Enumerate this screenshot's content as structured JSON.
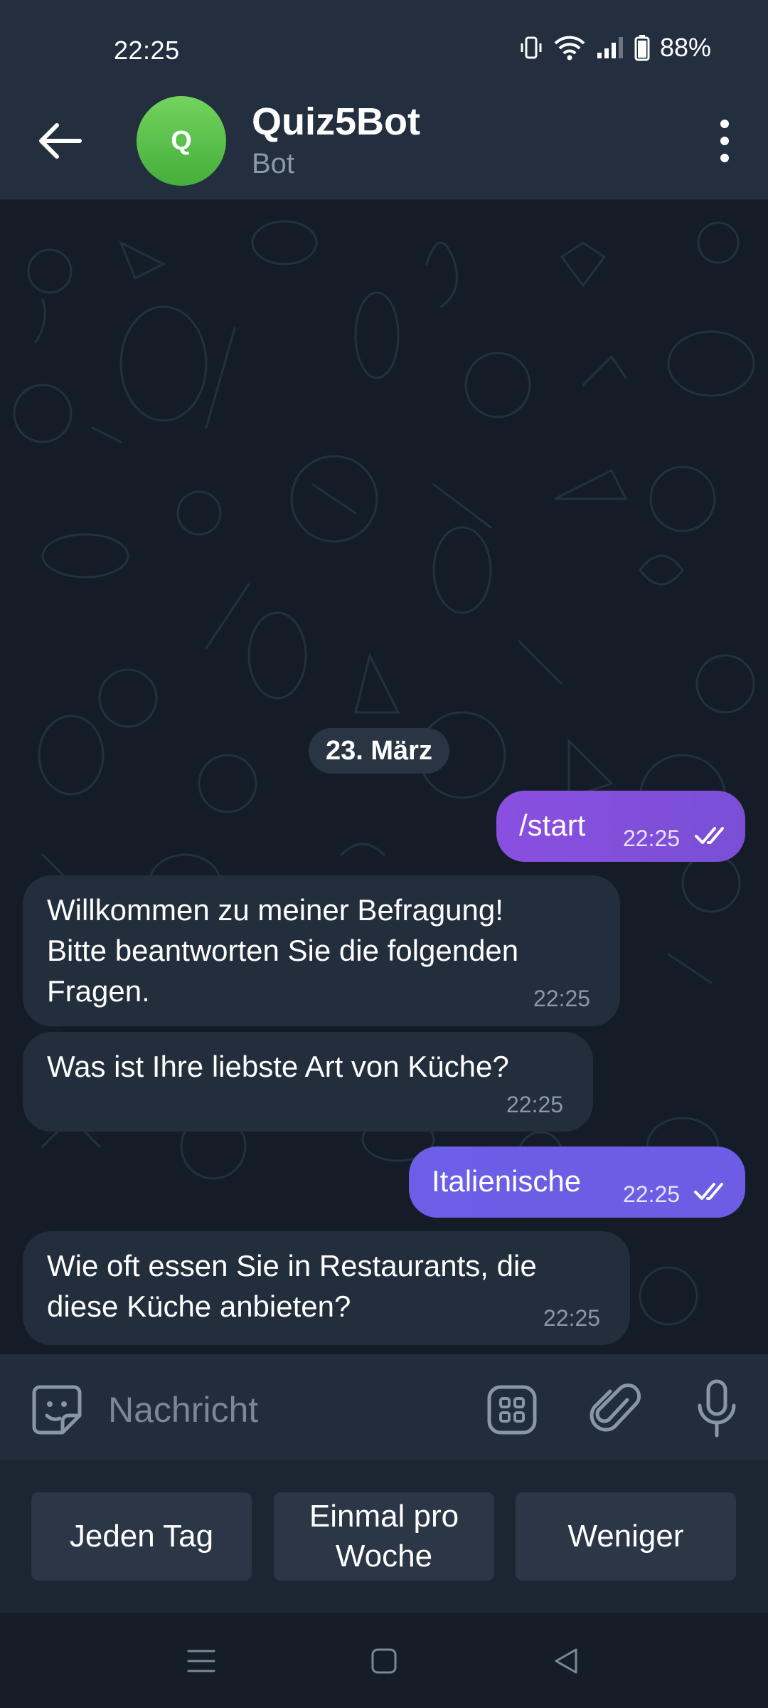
{
  "status_bar": {
    "time": "22:25",
    "battery": "88%"
  },
  "header": {
    "avatar_letter": "Q",
    "title": "Quiz5Bot",
    "subtitle": "Bot"
  },
  "chat": {
    "date_separator": "23. März",
    "messages": [
      {
        "direction": "out",
        "text": "/start",
        "time": "22:25",
        "status": "read"
      },
      {
        "direction": "in",
        "lines": [
          "Willkommen zu meiner Befragung!",
          "Bitte beantworten Sie die folgenden",
          "Fragen."
        ],
        "time": "22:25"
      },
      {
        "direction": "in",
        "lines": [
          "Was ist Ihre liebste Art von Küche?"
        ],
        "time": "22:25"
      },
      {
        "direction": "out",
        "text": "Italienische",
        "time": "22:25",
        "status": "read"
      },
      {
        "direction": "in",
        "lines": [
          "Wie oft essen Sie in Restaurants, die",
          "diese Küche anbieten?"
        ],
        "time": "22:25"
      }
    ]
  },
  "composer": {
    "placeholder": "Nachricht"
  },
  "reply_keyboard": [
    {
      "label": "Jeden Tag"
    },
    {
      "label": "Einmal pro Woche",
      "lines": [
        "Einmal pro",
        "Woche"
      ]
    },
    {
      "label": "Weniger"
    }
  ],
  "icons": {
    "back": "arrow-left-icon",
    "menu": "more-vertical-icon",
    "emoji": "sticker-icon",
    "keyboard": "bot-keyboard-icon",
    "attach": "paperclip-icon",
    "mic": "microphone-icon",
    "read_status": "double-check-icon"
  },
  "colors": {
    "header_bg": "#232f3e",
    "chat_bg": "#141c27",
    "incoming_bubble": "#232e3c",
    "outgoing_bubble_1": "#8a4fe0",
    "outgoing_bubble_2": "#6a5fe6",
    "avatar": "#5bc24c"
  }
}
